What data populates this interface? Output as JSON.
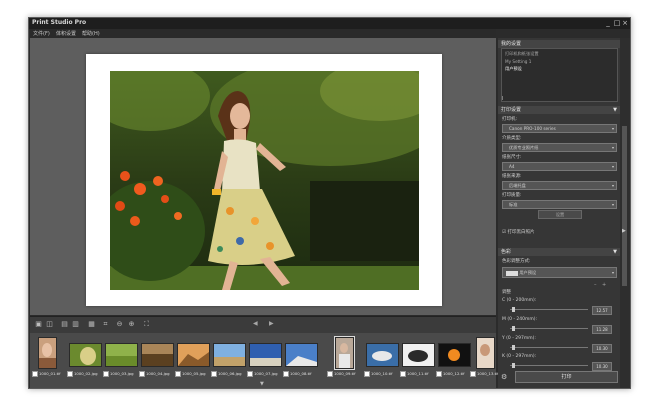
{
  "app": {
    "title": "Print Studio Pro"
  },
  "menu": [
    "文件(F)",
    "体积设置",
    "帮助(H)"
  ],
  "thumbnails": [
    {
      "label": "1000_01.tif",
      "portrait": true
    },
    {
      "label": "1000_02.jpg"
    },
    {
      "label": "1000_03.jpg"
    },
    {
      "label": "1000_04.jpg"
    },
    {
      "label": "1000_05.jpg"
    },
    {
      "label": "1000_06.jpg"
    },
    {
      "label": "1000_07.jpg"
    },
    {
      "label": "1000_08.tif"
    },
    {
      "label": "1000_09.tif",
      "portrait": true,
      "selected": true
    },
    {
      "label": "1000_10.tif"
    },
    {
      "label": "1000_11.tif"
    },
    {
      "label": "1000_12.tif"
    },
    {
      "label": "1000_13.tif",
      "portrait": true
    }
  ],
  "panel": {
    "settings_header": "我的设置",
    "settings_list": [
      "打印机和纸张设置",
      "My Setting 1",
      "用户预设"
    ],
    "print_settings_header": "打印设置",
    "printer_label": "打印机:",
    "printer_value": "Canon PRO-100 series",
    "media_label": "介质类型:",
    "media_value": "优质专业照片纸",
    "size_label": "纸张尺寸:",
    "size_value": "A4",
    "source_label": "纸张来源:",
    "source_value": "后端托盘",
    "quality_label": "打印质量:",
    "quality_value": "标准",
    "detail_button": "设置",
    "checkbox_label": "打印黑白照片",
    "color_header": "色彩",
    "color_mode_label": "色彩调整方式:",
    "color_mode_value": "用户预设",
    "adjust_label": "调整",
    "sliders": [
      {
        "label": "C (0 - 200mm):",
        "value": "12.57"
      },
      {
        "label": "M (0 - 240mm):",
        "value": "11.28"
      },
      {
        "label": "Y (0 - 297mm):",
        "value": "10.30"
      },
      {
        "label": "K (0 - 297mm):",
        "value": "10.30"
      }
    ],
    "print_button": "打印"
  },
  "colors": {
    "accent": "#dcdcdc"
  }
}
